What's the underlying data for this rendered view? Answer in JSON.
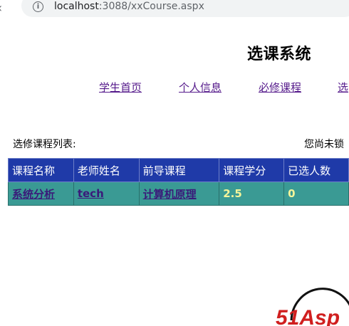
{
  "browser": {
    "url_host": "localhost",
    "url_path": ":3088/xxCourse.aspx",
    "info_icon": "i"
  },
  "page": {
    "title": "选课系统",
    "nav": [
      {
        "label": "学生首页"
      },
      {
        "label": "个人信息"
      },
      {
        "label": "必修课程"
      },
      {
        "label": "选"
      }
    ],
    "list_label": "选修课程列表:",
    "status_text": "您尚未锁"
  },
  "table": {
    "headers": [
      "课程名称",
      "老师姓名",
      "前导课程",
      "课程学分",
      "已选人数"
    ],
    "rows": [
      {
        "course_name": "系统分析",
        "teacher": "tech",
        "prereq": "计算机原理",
        "credits": "2.5",
        "selected_count": "0"
      }
    ]
  },
  "logo": {
    "text": "51Asp"
  },
  "colors": {
    "header_bg": "#1f3aa8",
    "row_bg": "#3a9a94",
    "link_visited": "#551a8b",
    "number_text": "#f5f59a"
  }
}
